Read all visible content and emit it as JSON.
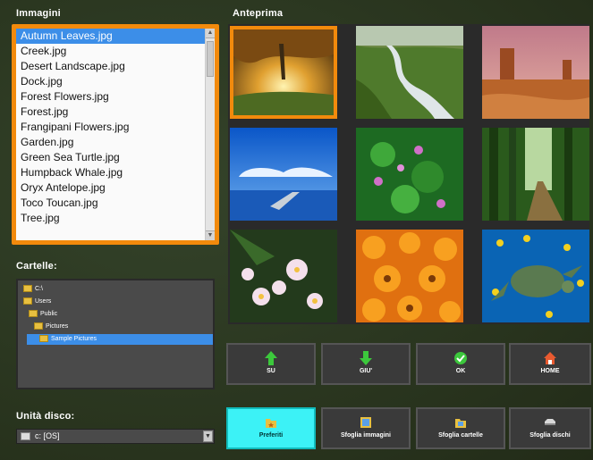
{
  "images": {
    "title": "Immagini",
    "files": [
      {
        "name": "Autumn Leaves.jpg",
        "selected": true
      },
      {
        "name": "Creek.jpg"
      },
      {
        "name": "Desert Landscape.jpg"
      },
      {
        "name": "Dock.jpg"
      },
      {
        "name": "Forest Flowers.jpg"
      },
      {
        "name": "Forest.jpg"
      },
      {
        "name": "Frangipani Flowers.jpg"
      },
      {
        "name": "Garden.jpg"
      },
      {
        "name": "Green Sea Turtle.jpg"
      },
      {
        "name": "Humpback Whale.jpg"
      },
      {
        "name": "Oryx Antelope.jpg"
      },
      {
        "name": "Toco Toucan.jpg"
      },
      {
        "name": "Tree.jpg"
      }
    ]
  },
  "folders": {
    "title": "Cartelle:",
    "items": [
      {
        "name": "C:\\"
      },
      {
        "name": "Users"
      },
      {
        "name": "Public"
      },
      {
        "name": "Pictures"
      },
      {
        "name": "Sample Pictures",
        "selected": true
      }
    ]
  },
  "disk": {
    "title": "Unità disco:",
    "value": "c: [OS]"
  },
  "preview": {
    "title": "Anteprima",
    "thumbnails": [
      {
        "name": "autumn-leaves",
        "selected": true
      },
      {
        "name": "creek"
      },
      {
        "name": "desert-landscape"
      },
      {
        "name": "dock"
      },
      {
        "name": "forest-flowers"
      },
      {
        "name": "forest"
      },
      {
        "name": "frangipani-flowers"
      },
      {
        "name": "garden"
      },
      {
        "name": "green-sea-turtle"
      }
    ]
  },
  "nav_buttons": [
    {
      "label": "SU",
      "icon": "arrow-up-icon"
    },
    {
      "label": "GIU'",
      "icon": "arrow-down-icon"
    },
    {
      "label": "OK",
      "icon": "ok-icon"
    },
    {
      "label": "HOME",
      "icon": "home-icon"
    }
  ],
  "mode_buttons": [
    {
      "label": "Preferiti",
      "icon": "favorites-icon",
      "active": true
    },
    {
      "label": "Sfoglia immagini",
      "icon": "browse-images-icon"
    },
    {
      "label": "Sfoglia cartelle",
      "icon": "browse-folders-icon"
    },
    {
      "label": "Sfoglia dischi",
      "icon": "browse-disks-icon"
    }
  ],
  "colors": {
    "accent": "#f28a0c",
    "selection": "#3c8ee8",
    "active_button": "#3cf2f6"
  }
}
